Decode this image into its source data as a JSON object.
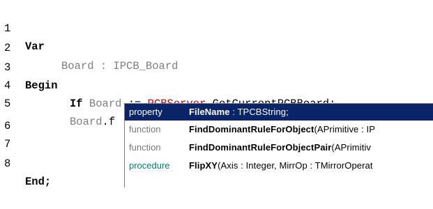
{
  "editor": {
    "lines": [
      {
        "num": "1",
        "kw": "Var"
      },
      {
        "num": "2",
        "ident": "Board",
        "colon": " : ",
        "type": "IPCB_Board"
      },
      {
        "num": "3",
        "kw": "Begin"
      },
      {
        "num": "4",
        "kw": "If",
        "ident": "Board",
        "assign": " := ",
        "server": "PCBServer",
        "rest": ".GetCurrentPCBBoard;"
      },
      {
        "num": "5",
        "ident": "Board",
        "rest": ".f"
      },
      {
        "num": "6"
      },
      {
        "num": "7"
      },
      {
        "num": "8",
        "kw": "End;"
      }
    ]
  },
  "completion": {
    "items": [
      {
        "kind": "property",
        "name": "FileName",
        "sig": " : TPCBString;",
        "selected": true
      },
      {
        "kind": "function",
        "name": "FindDominantRuleForObject",
        "sig": "(APrimitive : IP",
        "selected": false
      },
      {
        "kind": "function",
        "name": "FindDominantRuleForObjectPair",
        "sig": "(APrimitiv",
        "selected": false
      },
      {
        "kind": "procedure",
        "name": "FlipXY",
        "sig": "(Axis : Integer, MirrOp : TMirrorOperat",
        "selected": false
      }
    ]
  },
  "colors": {
    "keyword": "#000000",
    "identifier": "#808080",
    "object": "#cc0000",
    "selection": "#0a246a",
    "procedure_kind": "#008080"
  }
}
